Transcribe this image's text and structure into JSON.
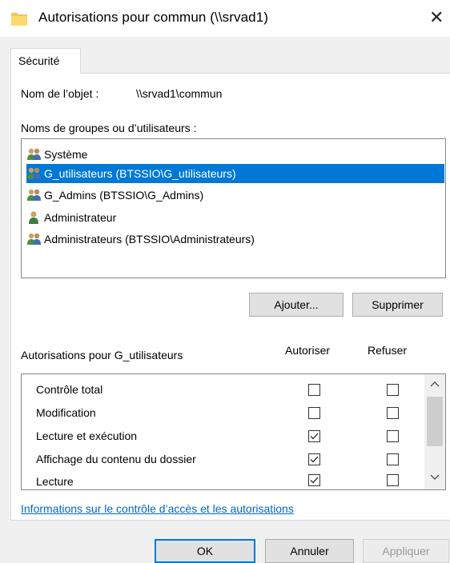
{
  "window": {
    "title": "Autorisations pour commun (\\\\srvad1)",
    "close_glyph": "✕"
  },
  "tabs": [
    {
      "label": "Sécurité"
    }
  ],
  "object": {
    "label": "Nom de l’objet :",
    "value": "\\\\srvad1\\commun"
  },
  "groups": {
    "label": "Noms de groupes ou d’utilisateurs :",
    "items": [
      {
        "label": "Système",
        "icon": "users-group-icon",
        "selected": false
      },
      {
        "label": "G_utilisateurs (BTSSIO\\G_utilisateurs)",
        "icon": "users-group-icon",
        "selected": true
      },
      {
        "label": "G_Admins (BTSSIO\\G_Admins)",
        "icon": "users-group-icon",
        "selected": false
      },
      {
        "label": "Administrateur",
        "icon": "user-icon",
        "selected": false
      },
      {
        "label": "Administrateurs (BTSSIO\\Administrateurs)",
        "icon": "users-group-icon",
        "selected": false
      }
    ]
  },
  "buttons": {
    "add": "Ajouter...",
    "remove": "Supprimer",
    "ok": "OK",
    "cancel": "Annuler",
    "apply": "Appliquer"
  },
  "permissions": {
    "title": "Autorisations pour G_utilisateurs",
    "col_allow": "Autoriser",
    "col_deny": "Refuser",
    "rows": [
      {
        "label": "Contrôle total",
        "allow": false,
        "deny": false
      },
      {
        "label": "Modification",
        "allow": false,
        "deny": false
      },
      {
        "label": "Lecture et exécution",
        "allow": true,
        "deny": false
      },
      {
        "label": "Affichage du contenu du dossier",
        "allow": true,
        "deny": false
      },
      {
        "label": "Lecture",
        "allow": true,
        "deny": false
      }
    ]
  },
  "help_link": "Informations sur le contrôle d’accès et les autorisations",
  "colors": {
    "selection": "#0078d7",
    "link": "#0066cc",
    "dialog_bg": "#f0f0f0"
  }
}
